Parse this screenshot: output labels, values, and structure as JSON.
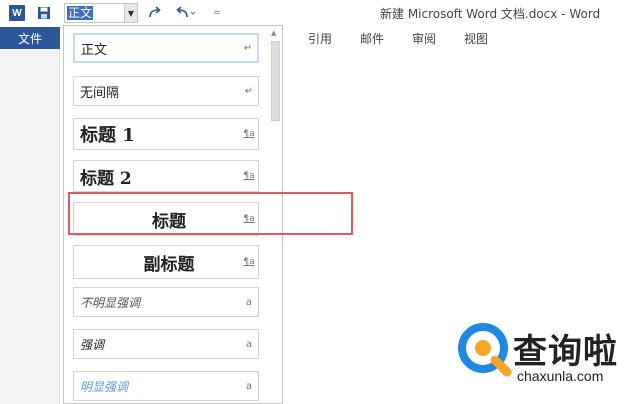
{
  "qat": {
    "app_icon_letter": "W",
    "style_combo_value": "正文",
    "window_title": "新建 Microsoft Word 文档.docx - Word"
  },
  "ribbon": {
    "file_tab": "文件",
    "tabs": [
      "引用",
      "邮件",
      "审阅",
      "视图"
    ]
  },
  "style_gallery": {
    "items": [
      {
        "label": "正文",
        "mark": "↵"
      },
      {
        "label": "无间隔",
        "mark": "↵"
      },
      {
        "label": "标题 1",
        "mark": "¶a"
      },
      {
        "label": "标题 2",
        "mark": "¶a"
      },
      {
        "label": "标题",
        "mark": "¶a"
      },
      {
        "label": "副标题",
        "mark": "¶a"
      },
      {
        "label": "不明显强调",
        "mark": "a"
      },
      {
        "label": "强调",
        "mark": "a"
      },
      {
        "label": "明显强调",
        "mark": "a"
      }
    ]
  },
  "watermark": {
    "text": "查询啦",
    "url": "chaxunla.com"
  },
  "colors": {
    "accent": "#2b579a",
    "highlight": "#e05a5a",
    "watermark_blue": "#1e88e5",
    "watermark_orange": "#f5a623"
  }
}
